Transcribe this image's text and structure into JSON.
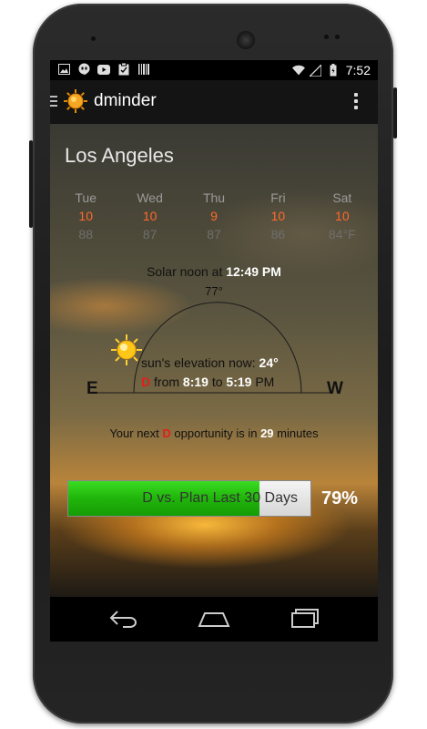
{
  "status_bar": {
    "time": "7:52",
    "left_icons": [
      "image-icon",
      "hangouts-icon",
      "youtube-icon",
      "clipboard-icon",
      "barcode-icon"
    ],
    "right_icons": [
      "wifi-icon",
      "signal-icon",
      "battery-icon"
    ]
  },
  "action_bar": {
    "title": "dminder"
  },
  "location": {
    "city": "Los Angeles"
  },
  "forecast": [
    {
      "day": "Tue",
      "value": "10",
      "temp": "88"
    },
    {
      "day": "Wed",
      "value": "10",
      "temp": "87"
    },
    {
      "day": "Thu",
      "value": "9",
      "temp": "87"
    },
    {
      "day": "Fri",
      "value": "10",
      "temp": "86"
    },
    {
      "day": "Sat",
      "value": "10",
      "temp": "84°F"
    }
  ],
  "sun_info": {
    "solar_noon_label": "Solar noon at ",
    "solar_noon_time": "12:49 PM",
    "noon_temp": "77°",
    "elevation_label": "sun's elevation now: ",
    "elevation_value": "24°",
    "range_d": "D",
    "range_from_label": " from ",
    "range_start": "8:19",
    "range_to_label": " to ",
    "range_end": "5:19",
    "range_pm": " PM",
    "east_label": "E",
    "west_label": "W",
    "elevation_deg": 24
  },
  "opportunity": {
    "prefix": "Your next ",
    "d": "D",
    "middle": " opportunity is in ",
    "minutes": "29",
    "suffix": " minutes"
  },
  "progress": {
    "label": "D vs. Plan Last 30 Days",
    "percent_text": "79%",
    "fraction": 0.79
  },
  "colors": {
    "accent_red": "#e0201a",
    "forecast_orange": "#ff6a2a",
    "progress_green": "#22b80c"
  }
}
